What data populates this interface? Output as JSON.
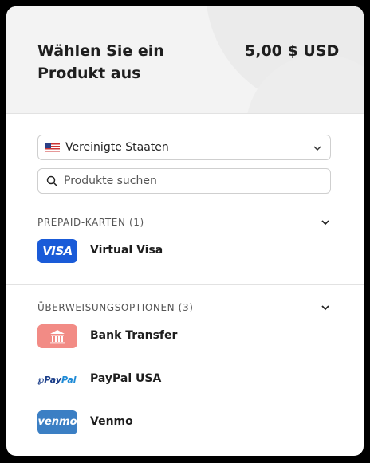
{
  "header": {
    "title": "Wählen Sie ein Produkt aus",
    "price": "5,00 $ USD"
  },
  "country_select": {
    "value": "Vereinigte Staaten",
    "flag_icon": "us-flag-icon"
  },
  "search": {
    "placeholder": "Produkte suchen"
  },
  "sections": [
    {
      "label": "PREPAID-KARTEN (1)",
      "items": [
        {
          "label": "Virtual Visa",
          "logo_text": "VISA",
          "icon": "visa-logo-icon",
          "color": "#1a5bd8"
        }
      ]
    },
    {
      "label": "ÜBERWEISUNGSOPTIONEN (3)",
      "items": [
        {
          "label": "Bank Transfer",
          "icon": "bank-icon",
          "color": "#f28b85"
        },
        {
          "label": "PayPal USA",
          "logo_text_1": "Pay",
          "logo_text_2": "Pal",
          "icon": "paypal-logo-icon"
        },
        {
          "label": "Venmo",
          "logo_text": "venmo",
          "icon": "venmo-logo-icon",
          "color": "#3b7fc4"
        }
      ]
    }
  ]
}
